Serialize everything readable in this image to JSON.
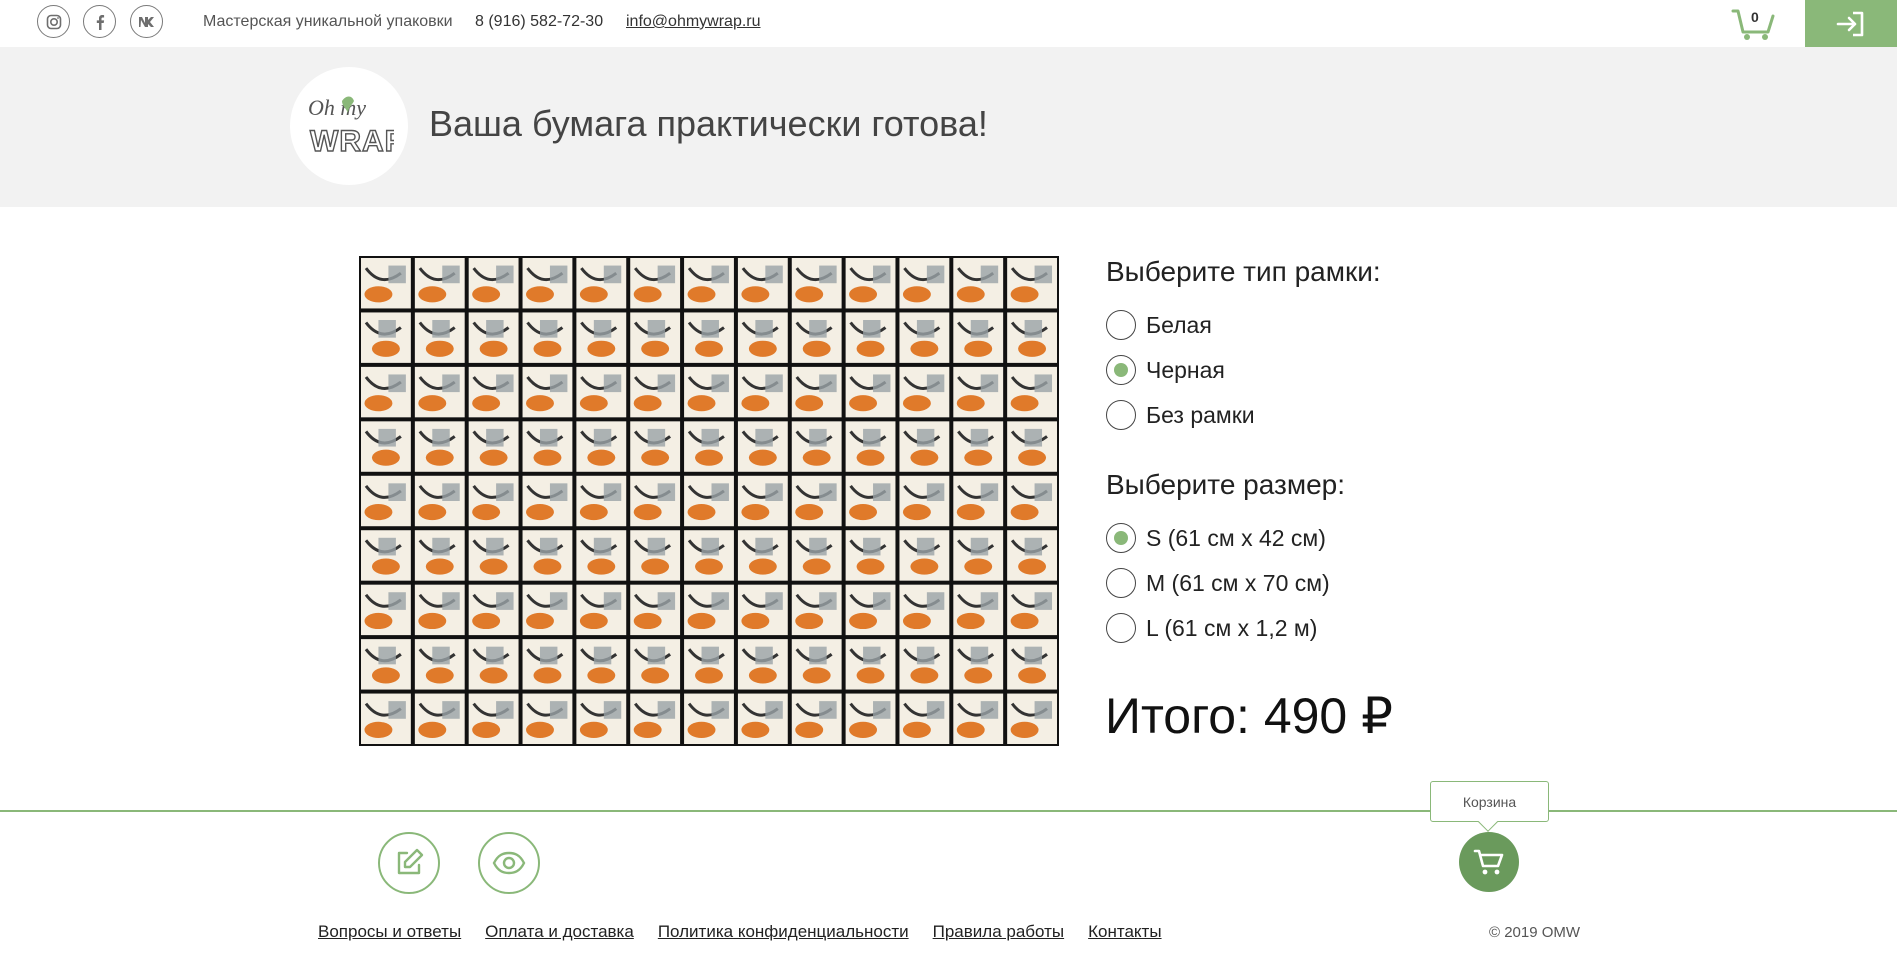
{
  "topbar": {
    "social": [
      {
        "name": "instagram",
        "icon": "instagram-icon",
        "glyph": "◎"
      },
      {
        "name": "facebook",
        "icon": "facebook-icon",
        "glyph": "f"
      },
      {
        "name": "vkontakte",
        "icon": "vk-icon",
        "glyph": "vk"
      }
    ],
    "tagline": "Мастерская уникальной упаковки",
    "phone": "8 (916) 582-72-30",
    "email": "info@ohmywrap.ru",
    "cart_count": "0",
    "cart_icon": "cart-icon",
    "login_icon": "login-icon"
  },
  "header": {
    "logo_top": "Oh my",
    "logo_bottom": "WRAP",
    "title": "Ваша бумага практически готова!"
  },
  "frame_options": {
    "heading": "Выберите тип рамки:",
    "options": [
      "Белая",
      "Черная",
      "Без рамки"
    ],
    "selected": 1
  },
  "size_options": {
    "heading": "Выберите размер:",
    "options": [
      "S (61 см х 42 см)",
      "M (61 см х 70 см)",
      "L (61 см х 1,2 м)"
    ],
    "selected": 0
  },
  "total": "Итого: 490 ₽",
  "actions": {
    "edit_icon": "edit-icon",
    "preview_icon": "eye-icon",
    "cart_icon": "cart-icon",
    "cart_tooltip": "Корзина"
  },
  "footer": {
    "links": [
      "Вопросы и ответы",
      "Оплата и доставка",
      "Политика конфиденциальности",
      "Правила работы",
      "Контакты"
    ],
    "copyright": "© 2019 OMW"
  },
  "colors": {
    "accent": "#8ab879",
    "accent_dark": "#6a9a5c",
    "header_bg": "#f2f2f2"
  }
}
